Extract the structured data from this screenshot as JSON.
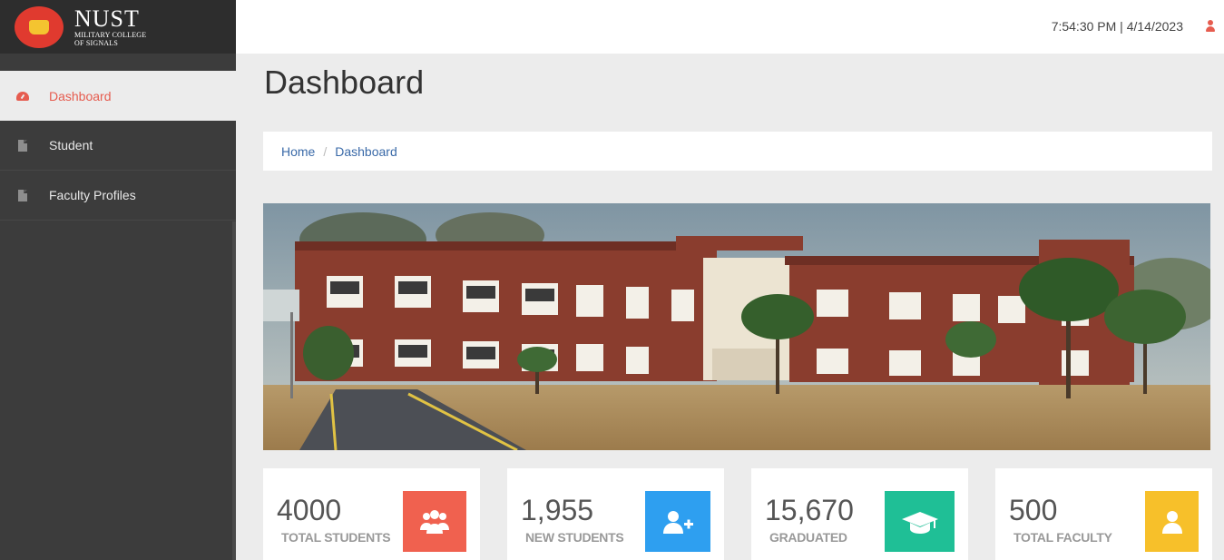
{
  "brand": {
    "title": "NUST",
    "subtitle_line1": "MILITARY COLLEGE",
    "subtitle_line2": "OF SIGNALS"
  },
  "topbar": {
    "datetime": "7:54:30 PM | 4/14/2023",
    "user_icon": "user-icon"
  },
  "sidebar": {
    "items": [
      {
        "label": "Dashboard",
        "icon": "dashboard-icon",
        "active": true
      },
      {
        "label": "Student",
        "icon": "file-icon",
        "active": false
      },
      {
        "label": "Faculty Profiles",
        "icon": "file-icon",
        "active": false
      }
    ]
  },
  "page": {
    "title": "Dashboard"
  },
  "breadcrumb": {
    "home": "Home",
    "sep": "/",
    "current": "Dashboard"
  },
  "stats": [
    {
      "value": "4000",
      "label": "TOTAL STUDENTS",
      "color": "#f0614f",
      "icon": "users-icon"
    },
    {
      "value": "1,955",
      "label": "NEW STUDENTS",
      "color": "#2e9ff0",
      "icon": "user-plus-icon"
    },
    {
      "value": "15,670",
      "label": "GRADUATED",
      "color": "#1fbf96",
      "icon": "graduation-cap-icon"
    },
    {
      "value": "500",
      "label": "TOTAL FACULTY",
      "color": "#f7c02a",
      "icon": "user-icon"
    }
  ]
}
